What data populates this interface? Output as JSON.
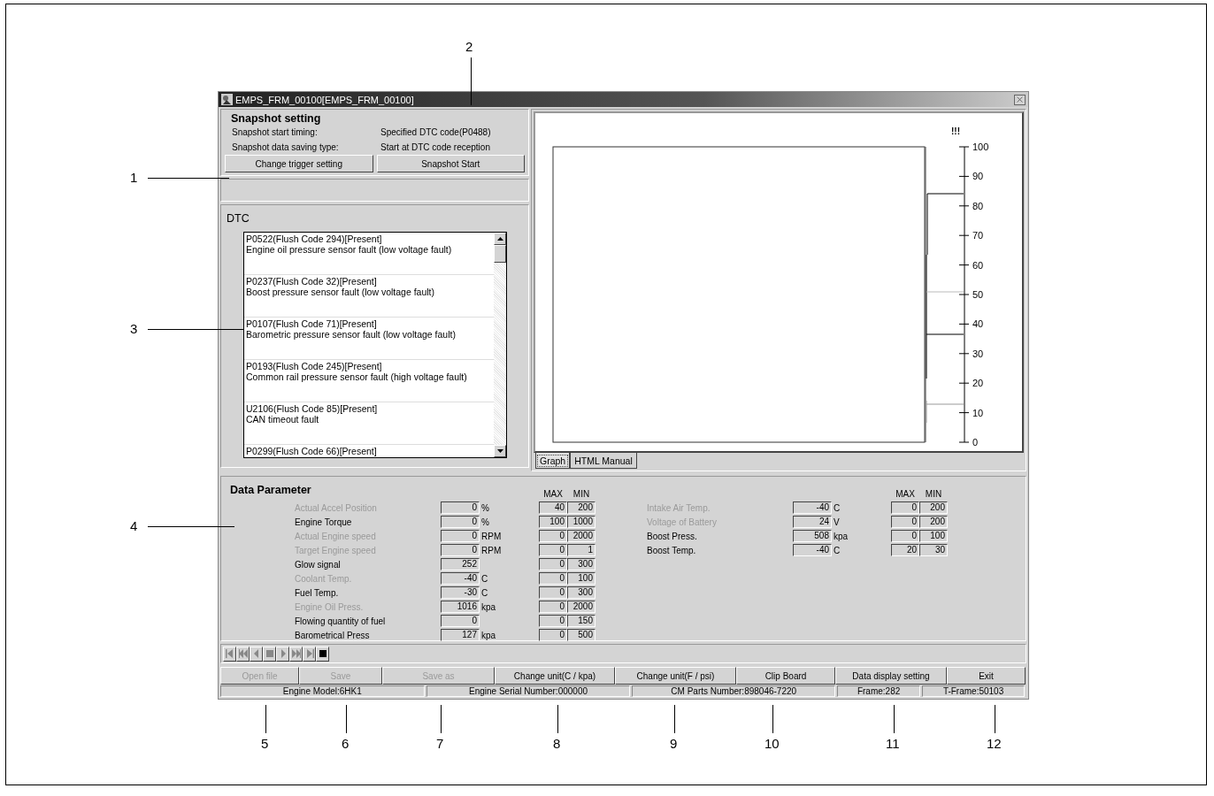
{
  "window": {
    "title": "EMPS_FRM_00100[EMPS_FRM_00100]"
  },
  "snapshot": {
    "title": "Snapshot setting",
    "rows": [
      {
        "label": "Snapshot start timing:",
        "value": "Specified DTC code(P0488)"
      },
      {
        "label": "Snapshot data saving type:",
        "value": "Start at DTC code reception"
      }
    ],
    "buttons": [
      "Change trigger setting",
      "Snapshot Start"
    ]
  },
  "dtc": {
    "title": "DTC",
    "items": [
      {
        "code": "P0522(Flush Code 294)[Present]",
        "description": "Engine oil pressure sensor fault (low voltage fault)"
      },
      {
        "code": "P0237(Flush Code 32)[Present]",
        "description": "Boost pressure sensor fault (low voltage fault)"
      },
      {
        "code": "P0107(Flush Code 71)[Present]",
        "description": "Barometric pressure sensor fault (low voltage fault)"
      },
      {
        "code": "P0193(Flush Code 245)[Present]",
        "description": "Common rail pressure sensor fault (high voltage fault)"
      },
      {
        "code": "U2106(Flush Code 85)[Present]",
        "description": "CAN timeout fault"
      },
      {
        "code": "P0299(Flush Code 66)[Present]"
      }
    ]
  },
  "graph": {
    "marker": "!!!",
    "yticks": [
      "100",
      "90",
      "80",
      "70",
      "60",
      "50",
      "40",
      "30",
      "20",
      "10",
      "0"
    ]
  },
  "tabs": [
    {
      "label": "Graph",
      "selected": true
    },
    {
      "label": "HTML Manual",
      "selected": false
    }
  ],
  "data_parameter": {
    "title": "Data Parameter",
    "groups": [
      {
        "max_header": "MAX",
        "min_header": "MIN",
        "rows": [
          {
            "name": "Actual Accel Position",
            "disabled": true,
            "value": "0",
            "unit": "%",
            "max": "40",
            "min": "200"
          },
          {
            "name": "Engine Torque",
            "disabled": false,
            "value": "0",
            "unit": "%",
            "max": "100",
            "min": "1000"
          },
          {
            "name": "Actual Engine speed",
            "disabled": true,
            "value": "0",
            "unit": "RPM",
            "max": "0",
            "min": "2000"
          },
          {
            "name": "Target Engine speed",
            "disabled": true,
            "value": "0",
            "unit": "RPM",
            "max": "0",
            "min": "1"
          },
          {
            "name": "Glow signal",
            "disabled": false,
            "value": "252",
            "max": "0",
            "min": "300"
          },
          {
            "name": "Coolant Temp.",
            "disabled": true,
            "value": "-40",
            "unit": "C",
            "max": "0",
            "min": "100"
          },
          {
            "name": "Fuel Temp.",
            "disabled": false,
            "value": "-30",
            "unit": "C",
            "max": "0",
            "min": "300"
          },
          {
            "name": "Engine Oil Press.",
            "disabled": true,
            "value": "1016",
            "unit": "kpa",
            "max": "0",
            "min": "2000"
          },
          {
            "name": "Flowing quantity of fuel",
            "disabled": false,
            "value": "0",
            "max": "0",
            "min": "150"
          },
          {
            "name": "Barometrical Press",
            "disabled": false,
            "value": "127",
            "unit": "kpa",
            "max": "0",
            "min": "500"
          }
        ]
      },
      {
        "max_header": "MAX",
        "min_header": "MIN",
        "rows": [
          {
            "name": "Intake Air Temp.",
            "disabled": true,
            "value": "-40",
            "unit": "C",
            "max": "0",
            "min": "200"
          },
          {
            "name": "Voltage of Battery",
            "disabled": true,
            "value": "24",
            "unit": "V",
            "max": "0",
            "min": "200"
          },
          {
            "name": "Boost Press.",
            "disabled": false,
            "value": "508",
            "unit": "kpa",
            "max": "0",
            "min": "100"
          },
          {
            "name": "Boost Temp.",
            "disabled": false,
            "value": "-40",
            "unit": "C",
            "max": "20",
            "min": "30"
          }
        ]
      }
    ]
  },
  "buttons": [
    {
      "label": "Open file",
      "disabled": true
    },
    {
      "label": "Save",
      "disabled": true
    },
    {
      "label": "Save as",
      "disabled": true
    },
    {
      "label": "Change unit(C / kpa)",
      "disabled": false
    },
    {
      "label": "Change unit(F / psi)",
      "disabled": false
    },
    {
      "label": "Clip Board",
      "disabled": false
    },
    {
      "label": "Data display setting",
      "disabled": false
    },
    {
      "label": "Exit",
      "disabled": false
    }
  ],
  "status_bar": [
    "Engine Model:6HK1",
    "Engine Serial Number:000000",
    "CM Parts Number:898046-7220",
    "Frame:282",
    "T-Frame:50103"
  ],
  "callouts": [
    "1",
    "2",
    "3",
    "4",
    "5",
    "6",
    "7",
    "8",
    "9",
    "10",
    "11",
    "12"
  ]
}
